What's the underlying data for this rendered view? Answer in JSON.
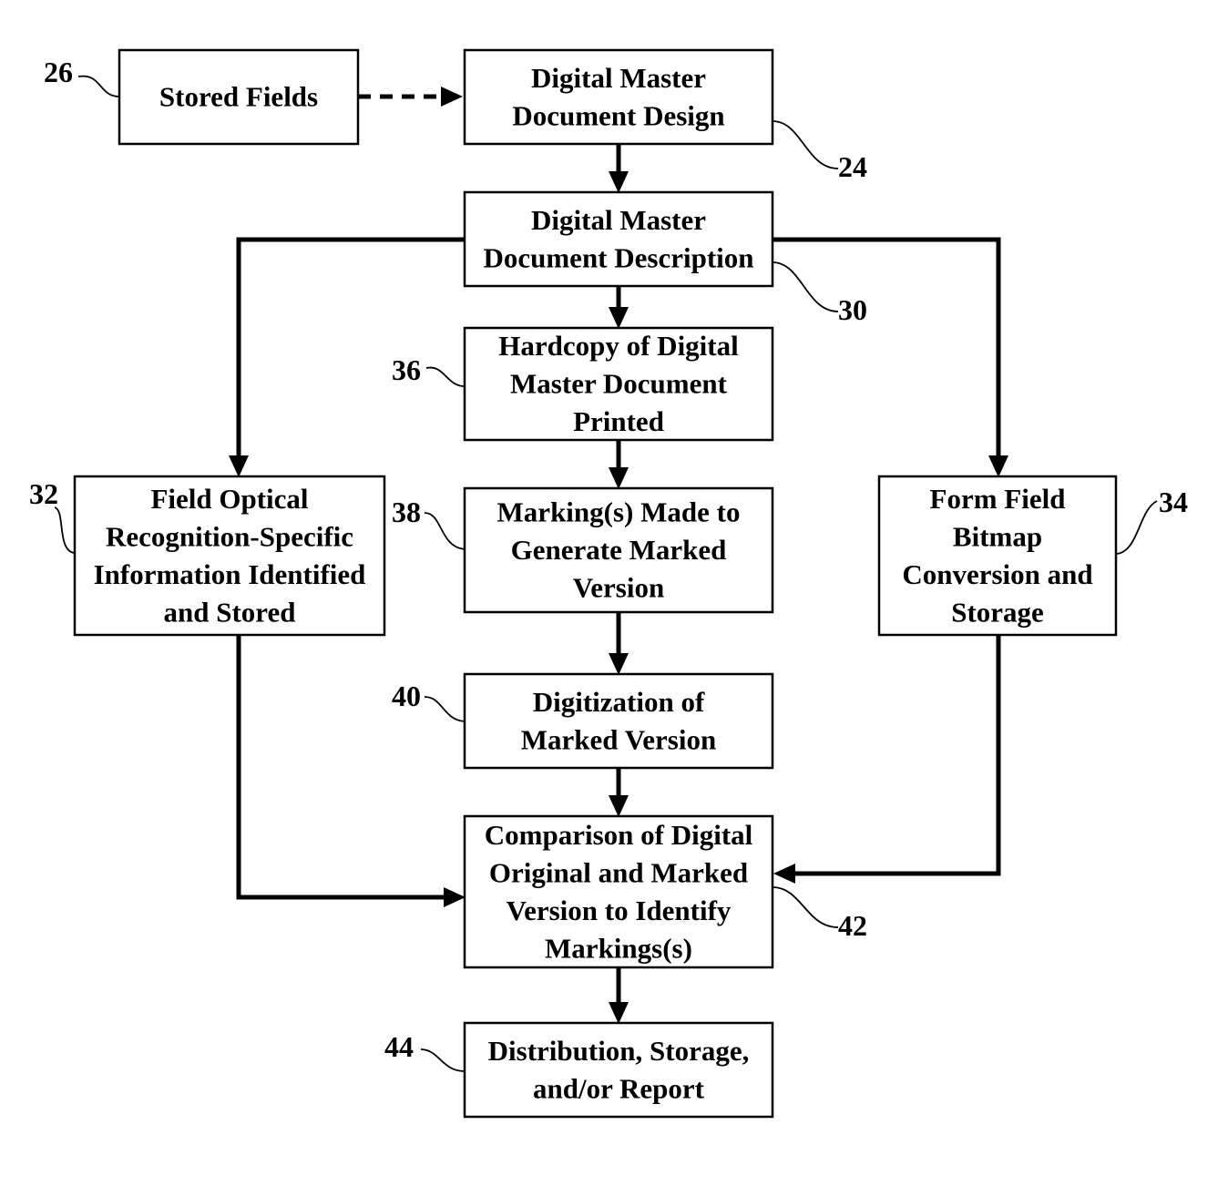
{
  "diagram": {
    "type": "flowchart",
    "nodes": [
      {
        "id": "26",
        "ref": "26",
        "lines": [
          "Stored Fields"
        ]
      },
      {
        "id": "24",
        "ref": "24",
        "lines": [
          "Digital Master",
          "Document Design"
        ]
      },
      {
        "id": "30",
        "ref": "30",
        "lines": [
          "Digital Master",
          "Document Description"
        ]
      },
      {
        "id": "36",
        "ref": "36",
        "lines": [
          "Hardcopy of Digital",
          "Master Document",
          "Printed"
        ]
      },
      {
        "id": "32",
        "ref": "32",
        "lines": [
          "Field Optical",
          "Recognition-Specific",
          "Information Identified",
          "and Stored"
        ]
      },
      {
        "id": "38",
        "ref": "38",
        "lines": [
          "Marking(s) Made to",
          "Generate Marked",
          "Version"
        ]
      },
      {
        "id": "34",
        "ref": "34",
        "lines": [
          "Form Field",
          "Bitmap",
          "Conversion and",
          "Storage"
        ]
      },
      {
        "id": "40",
        "ref": "40",
        "lines": [
          "Digitization of",
          "Marked Version"
        ]
      },
      {
        "id": "42",
        "ref": "42",
        "lines": [
          "Comparison of Digital",
          "Original and Marked",
          "Version to Identify",
          "Markings(s)"
        ]
      },
      {
        "id": "44",
        "ref": "44",
        "lines": [
          "Distribution, Storage,",
          "and/or Report"
        ]
      }
    ],
    "edges": [
      {
        "from": "26",
        "to": "24",
        "style": "dashed"
      },
      {
        "from": "24",
        "to": "30",
        "style": "solid"
      },
      {
        "from": "30",
        "to": "36",
        "style": "solid"
      },
      {
        "from": "30",
        "to": "32",
        "style": "solid"
      },
      {
        "from": "30",
        "to": "34",
        "style": "solid"
      },
      {
        "from": "36",
        "to": "38",
        "style": "solid"
      },
      {
        "from": "38",
        "to": "40",
        "style": "solid"
      },
      {
        "from": "40",
        "to": "42",
        "style": "solid"
      },
      {
        "from": "32",
        "to": "42",
        "style": "solid"
      },
      {
        "from": "34",
        "to": "42",
        "style": "solid"
      },
      {
        "from": "42",
        "to": "44",
        "style": "solid"
      }
    ]
  }
}
